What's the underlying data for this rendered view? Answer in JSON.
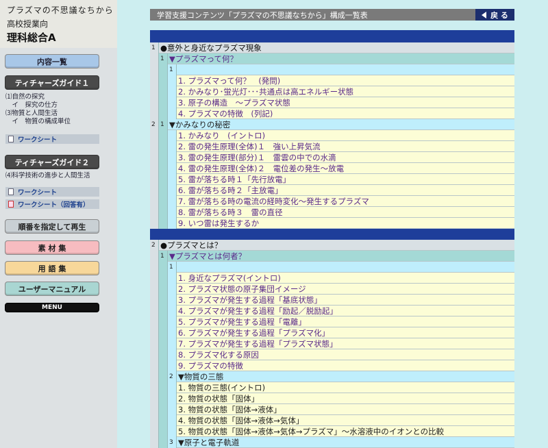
{
  "brand": {
    "line1": "プラズマの不思議なちから",
    "line2": "高校授業向",
    "line3": "理科総合A"
  },
  "sidebar": {
    "contents_btn": "内容一覧",
    "guide1_btn": "ティチャーズガイド１",
    "guide1_links": [
      "⑴自然の探究",
      "　イ　探究の仕方",
      "⑶物質と人間生活",
      "　イ　物質の構成単位"
    ],
    "worksheet1": "ワークシート",
    "guide2_btn": "ティチャーズガイド２",
    "guide2_link": "⑷科学技術の進歩と人間生活",
    "worksheet2": "ワークシート",
    "worksheet2_ans": "ワークシート（回答有）",
    "play_btn": "順番を指定して再生",
    "material_btn": "素 材 集",
    "glossary_btn": "用 語 集",
    "manual_btn": "ユーザーマニュアル",
    "menu_btn": "MENU"
  },
  "header": {
    "title": "学習支援コンテンツ「プラズマの不思議なちから」構成一覧表",
    "back": "戻 る"
  },
  "table": {
    "s1": {
      "num": "1",
      "title": "●意外と身近なプラズマ現象"
    },
    "s1_1": {
      "num": "1",
      "title": "▼プラズマって何？"
    },
    "s1_1_sub": "1",
    "s1_1_items": [
      "1. プラズマって何？　(発問)",
      "2. かみなり･蛍光灯･･･共通点は高エネルギー状態",
      "3. 原子の構造　～プラズマ状態",
      "4. プラズマの特徴　(列記)"
    ],
    "s1_2": {
      "num": "2",
      "sub": "1",
      "title": "▼かみなりの秘密"
    },
    "s1_2_items": [
      "1. かみなり　(イントロ)",
      "2. 雷の発生原理(全体)１　強い上昇気流",
      "3. 雷の発生原理(部分)１　雷雲の中での水滴",
      "4. 雷の発生原理(全体)２　電位差の発生～放電",
      "5. 雷が落ちる時１「先行放電」",
      "6. 雷が落ちる時２「主放電」",
      "7. 雷が落ちる時の電流の経時変化～発生するプラズマ",
      "8. 雷が落ちる時３　雷の直径",
      "9. いつ雷は発生するか"
    ],
    "s2": {
      "num": "2",
      "title": "●プラズマとは？"
    },
    "s2_1": {
      "num": "1",
      "title": "▼プラズマとは何者？"
    },
    "s2_1_sub": "1",
    "s2_1_items": [
      "1. 身近なプラズマ(イントロ)",
      "2. プラズマ状態の原子集団イメージ",
      "3. プラズマが発生する過程「基底状態」",
      "4. プラズマが発生する過程「励起／脱励起」",
      "5. プラズマが発生する過程「電離」",
      "6. プラズマが発生する過程「プラズマ化」",
      "7. プラズマが発生する過程「プラズマ状態」",
      "8. プラズマ化する原因",
      "9. プラズマの特徴"
    ],
    "s2_2": {
      "num": "2",
      "title": "▼物質の三態"
    },
    "s2_2_items": [
      "1. 物質の三態(イントロ)",
      "2. 物質の状態「固体」",
      "3. 物質の状態「固体→液体」",
      "4. 物質の状態「固体→液体→気体」",
      "5. 物質の状態「固体→液体→気体→プラズマ」～水溶液中のイオンとの比較"
    ],
    "s2_3": {
      "num": "3",
      "title": "▼原子と電子軌道"
    }
  }
}
